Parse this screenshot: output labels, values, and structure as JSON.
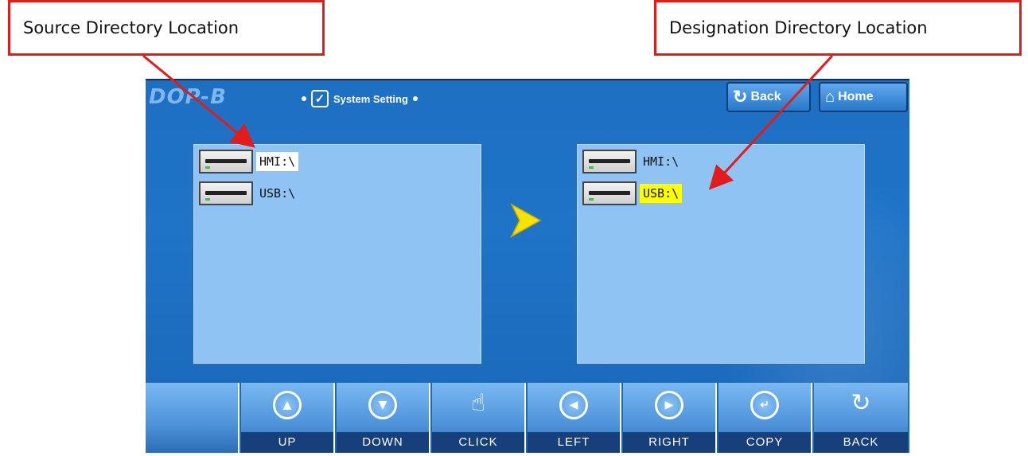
{
  "callouts": {
    "source": "Source Directory Location",
    "destination": "Designation Directory Location"
  },
  "header": {
    "logo": "DOP-B",
    "title": "System Setting",
    "back_label": "Back",
    "home_label": "Home"
  },
  "source_panel": {
    "items": [
      {
        "label": "HMI:\\",
        "highlight": "white"
      },
      {
        "label": "USB:\\",
        "highlight": "none"
      }
    ]
  },
  "destination_panel": {
    "items": [
      {
        "label": "HMI:\\",
        "highlight": "none"
      },
      {
        "label": "USB:\\",
        "highlight": "yellow"
      }
    ]
  },
  "toolbar": {
    "buttons": [
      {
        "label": "",
        "icon": "blank"
      },
      {
        "label": "UP",
        "icon": "up-icon"
      },
      {
        "label": "DOWN",
        "icon": "down-icon"
      },
      {
        "label": "CLICK",
        "icon": "hand-pointer-icon"
      },
      {
        "label": "LEFT",
        "icon": "left-icon"
      },
      {
        "label": "RIGHT",
        "icon": "right-icon"
      },
      {
        "label": "COPY",
        "icon": "enter-icon"
      },
      {
        "label": "BACK",
        "icon": "back-icon"
      }
    ]
  },
  "colors": {
    "callout_border": "#e21b1b",
    "screen_bg": "#1d6fc2",
    "panel_bg": "#8fc3f3",
    "highlight_yellow": "#ffff00",
    "arrow_yellow": "#f5e400"
  }
}
